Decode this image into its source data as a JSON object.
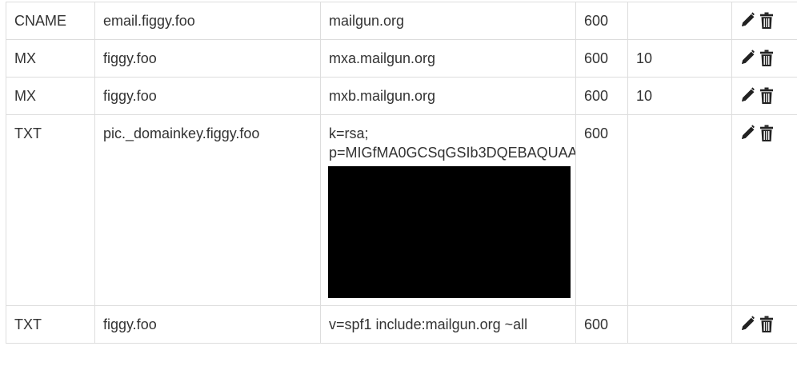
{
  "records": [
    {
      "type": "CNAME",
      "host": "email.figgy.foo",
      "value_lines": [
        "mailgun.org"
      ],
      "ttl": "600",
      "priority": "",
      "redacted": false
    },
    {
      "type": "MX",
      "host": "figgy.foo",
      "value_lines": [
        "mxa.mailgun.org"
      ],
      "ttl": "600",
      "priority": "10",
      "redacted": false
    },
    {
      "type": "MX",
      "host": "figgy.foo",
      "value_lines": [
        "mxb.mailgun.org"
      ],
      "ttl": "600",
      "priority": "10",
      "redacted": false
    },
    {
      "type": "TXT",
      "host": "pic._domainkey.figgy.foo",
      "value_lines": [
        "k=rsa;",
        "p=MIGfMA0GCSqGSIb3DQEBAQUAA"
      ],
      "ttl": "600",
      "priority": "",
      "redacted": true
    },
    {
      "type": "TXT",
      "host": "figgy.foo",
      "value_lines": [
        "v=spf1 include:mailgun.org ~all"
      ],
      "ttl": "600",
      "priority": "",
      "redacted": false
    }
  ],
  "icons": {
    "edit": "pencil-icon",
    "delete": "trash-icon"
  }
}
